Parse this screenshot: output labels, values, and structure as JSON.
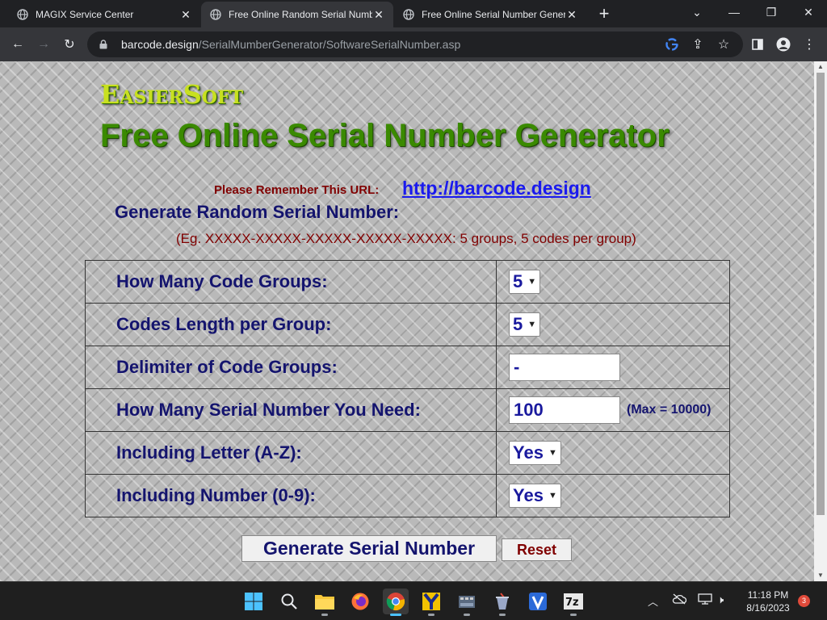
{
  "browser": {
    "tabs": [
      {
        "title": "MAGIX Service Center",
        "active": false
      },
      {
        "title": "Free Online Random Serial Numb",
        "active": true
      },
      {
        "title": "Free Online Serial Number Gener",
        "active": false
      }
    ],
    "new_tab": "+",
    "url_host": "barcode.design",
    "url_path": "/SerialMumberGenerator/SoftwareSerialNumber.asp"
  },
  "page": {
    "brand": "EasierSoft",
    "heading": "Free Online Serial Number Generator",
    "remember_label": "Please Remember This URL:",
    "remember_link": "http://barcode.design",
    "subheading": "Generate Random Serial Number:",
    "example": "(Eg. XXXXX-XXXXX-XXXXX-XXXXX-XXXXX:  5 groups, 5 codes per group)",
    "fields": {
      "groups": {
        "label": "How Many Code Groups:",
        "value": "5"
      },
      "length": {
        "label": "Codes Length per Group:",
        "value": "5"
      },
      "delimiter": {
        "label": "Delimiter of Code Groups:",
        "value": "-"
      },
      "count": {
        "label": "How Many Serial Number You Need:",
        "value": "100",
        "note": "(Max = 10000)"
      },
      "letters": {
        "label": "Including Letter (A-Z):",
        "value": "Yes"
      },
      "numbers": {
        "label": "Including Number (0-9):",
        "value": "Yes"
      }
    },
    "generate_button": "Generate Serial Number",
    "reset_button": "Reset"
  },
  "taskbar": {
    "time": "11:18 PM",
    "date": "8/16/2023",
    "notification_count": "3",
    "icons": [
      "windows-start-icon",
      "search-icon",
      "file-explorer-icon",
      "firefox-icon",
      "chrome-icon",
      "app-y-icon",
      "video-editor-icon",
      "app-cup-icon",
      "app-v-icon",
      "7zip-icon"
    ]
  },
  "colors": {
    "heading_green": "#3a8a00",
    "label_navy": "#14146e",
    "maroon": "#800000",
    "link_blue": "#1a1aee"
  }
}
